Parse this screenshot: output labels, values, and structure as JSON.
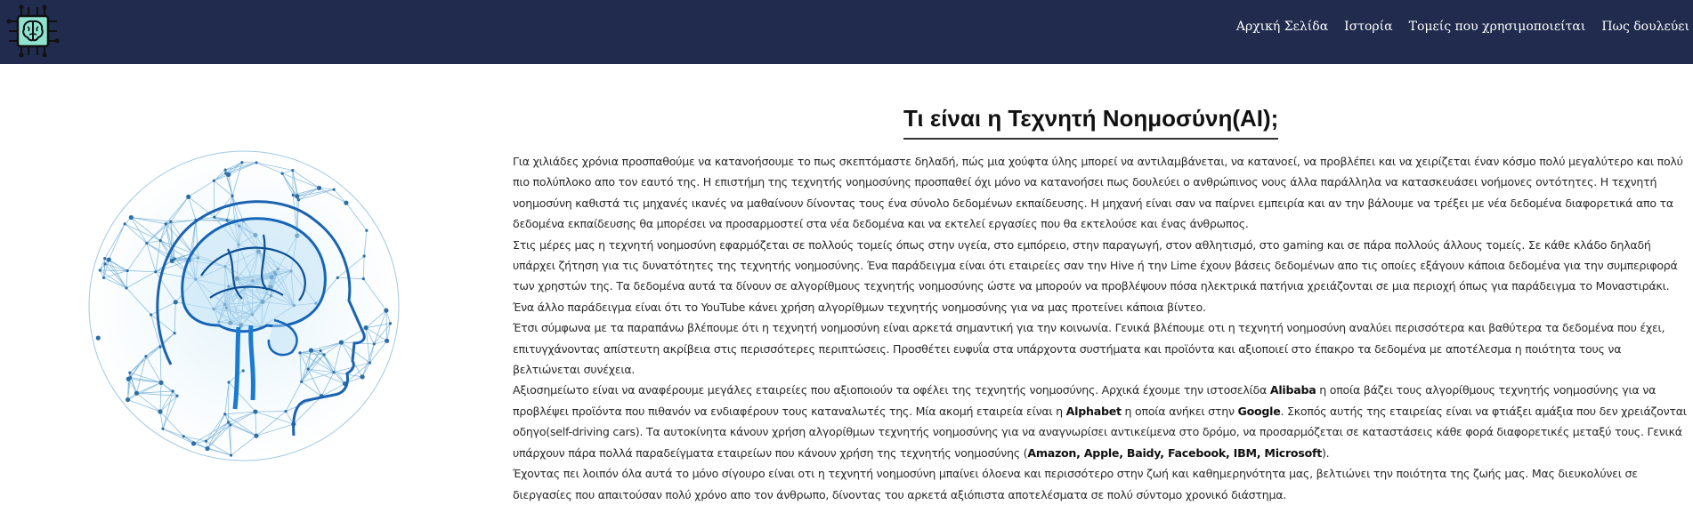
{
  "nav": {
    "logo": "brain-chip-logo",
    "links": [
      "Αρχική Σελίδα",
      "Ιστορία",
      "Τομείς που χρησιμοποιείται",
      "Πως δουλεύει"
    ]
  },
  "hero": {
    "image": "ai-brain-network-illustration"
  },
  "page": {
    "title": "Τι είναι η Τεχνητή Νοημοσύνη(AI);"
  },
  "paragraphs": [
    "Για χιλιάδες χρόνια προσπαθούμε να κατανοήσουμε το πως σκεπτόμαστε δηλαδή, πώς μια χούφτα ύλης μπορεί να αντιλαμβάνεται, να κατανοεί, να προβλέπει και να χειρίζεται έναν κόσμο πολύ μεγαλύτερο και πολύ πιο πολύπλοκο απο τον εαυτό της. Η επιστήμη της τεχνητής νοημοσύνης προσπαθεί όχι μόνο να κατανοήσει πως δουλεύει ο ανθρώπινος νους άλλα παράλληλα να κατασκευάσει νοήμονες οντότητες. Η τεχνητή νοημοσύνη καθιστά τις μηχανές ικανές να μαθαίνουν δίνοντας τους ένα σύνολο δεδομένων εκπαίδευσης. Η μηχανή είναι σαν να παίρνει εμπειρία και αν την βάλουμε να τρέξει με νέα δεδομένα διαφορετικά απο τα δεδομένα εκπαίδευσης θα μπορέσει να προσαρμοστεί στα νέα δεδομένα και να εκτελεί εργασίες που θα εκτελούσε και ένας άνθρωπος.",
    "Στις μέρες μας η τεχνητή νοημοσύνη εφαρμόζεται σε πολλούς τομείς όπως στην υγεία, στο εμπόρειο, στην παραγωγή, στον αθλητισμό, στο gaming και σε πάρα πολλούς άλλους τομείς. Σε κάθε κλάδο δηλαδή υπάρχει ζήτηση για τις δυνατότητες της τεχνητής νοημοσύνης. Ένα παράδειγμα είναι ότι εταιρείες σαν την Hive ή την Lime έχουν βάσεις δεδομένων απο τις οποίες εξάγουν κάποια δεδομένα για την συμπεριφορά των χρηστών της. Τα δεδομένα αυτά τα δίνουν σε αλγορίθμους τεχνητής νοημοσύνης ώστε να μπορούν να προβλέψουν πόσα ηλεκτρικά πατήνια χρειάζονται σε μια περιοχή όπως για παράδειγμα το Μοναστιράκι. Ένα άλλο παράδειγμα είναι ότι το YouTube κάνει χρήση αλγορίθμων τεχνητής νοημοσύνης για να μας προτείνει κάποια βίντεο.",
    "Έτσι σύμφωνα με τα παραπάνω βλέπουμε ότι η τεχνητή νοημοσύνη είναι αρκετά σημαντική για την κοινωνία. Γενικά βλέπουμε οτι η τεχνητή νοημοσύνη αναλύει περισσότερα και βαθύτερα τα δεδομένα που έχει, επιτυγχάνοντας απίστευτη ακρίβεια στις περισσότερες περιπτώσεις. Προσθέτει ευφυΐα στα υπάρχοντα συστήματα και προϊόντα και αξιοποιεί στο έπακρο τα δεδομένα με αποτέλεσμα η ποιότητα τους να βελτιώνεται συνέχεια.",
    "Αξιοσημείωτο είναι να αναφέρουμε μεγάλες εταιρείες που αξιοποιούν τα οφέλει της τεχνητής νοημοσύνης. Αρχικά έχουμε την ιστοσελίδα Alibaba η οποία βάζει τους αλγορίθμους τεχνητής νοημοσύνης για να προβλέψει προϊόντα που πιθανόν να ενδιαφέρουν τους καταναλωτές της. Μία ακομή εταιρεία είναι η Alphabet η οποία ανήκει στην Google. Σκοπός αυτής της εταιρείας είναι να φτιάξει αμάξια που δεν χρειάζονται οδηγο(self-driving cars). Τα αυτοκίνητα κάνουν χρήση αλγορίθμων τεχνητής νοημοσύνης για να αναγνωρίσει αντικείμενα στο δρόμο, να προσαρμόζεται σε καταστάσεις κάθε φορά διαφορετικές μεταξύ τους. Γενικά υπάρχουν πάρα πολλά παραδείγματα εταιρείων που κάνουν χρήση της τεχνητής νοημοσύνης (Amazon, Apple, Baidy, Facebook, IBM, Microsoft).",
    "Έχοντας πει λοιπόν όλα αυτά το μόνο σίγουρο είναι οτι η τεχνητή νοημοσύνη μπαίνει όλοενα και περισσότερο στην ζωή και καθημερηνότητα μας, βελτιώνει την ποιότητα της ζωής μας. Μας διευκολύνει σε διεργασίες που απαιτούσαν πολύ χρόνο απο τον άνθρωπο, δίνοντας του αρκετά αξιόπιστα αποτελέσματα σε πολύ σύντομο χρονικό διάστημα."
  ],
  "bold_terms": [
    "Alibaba",
    "Alphabet",
    "Google",
    "Amazon, Apple, Baidy, Facebook, IBM, Microsoft"
  ]
}
